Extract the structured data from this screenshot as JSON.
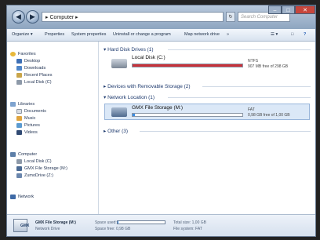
{
  "window": {
    "address": "▸ Computer ▸",
    "search_placeholder": "Search Computer",
    "back_glyph": "◀",
    "forward_glyph": "▶",
    "addr_dropdown": "▾",
    "refresh_glyph": "↻",
    "min": "–",
    "max": "□",
    "close": "✕"
  },
  "toolbar": {
    "organize": "Organize ▾",
    "properties": "Properties",
    "system_properties": "System properties",
    "uninstall": "Uninstall or change a program",
    "map_drive": "Map network drive",
    "more": "»",
    "view_icon": "☰ ▾",
    "pane_icon": "□",
    "help_icon": "?"
  },
  "sidebar": {
    "favorites": "Favorites",
    "desktop": "Desktop",
    "downloads": "Downloads",
    "recent": "Recent Places",
    "local_disk_fav": "Local Disk (C)",
    "libraries": "Libraries",
    "documents": "Documents",
    "music": "Music",
    "pictures": "Pictures",
    "videos": "Videos",
    "computer": "Computer",
    "local_disk": "Local Disk (C)",
    "gmx": "GMX File Storage (M:)",
    "zumodrive": "ZumoDrive (Z:)",
    "network": "Network"
  },
  "content": {
    "hdd_group": "Hard Disk Drives (1)",
    "local_disk_name": "Local Disk (C:)",
    "local_fs": "NTFS",
    "local_free": "907 MB free of 298 GB",
    "local_used_fraction": 0.997,
    "removable_group": "Devices with Removable Storage (2)",
    "network_group": "Network Location (1)",
    "gmx_name": "GMX File Storage (M:)",
    "gmx_fs": "FAT",
    "gmx_free": "0,98 GB free of 1,00 GB",
    "gmx_used_fraction": 0.02,
    "other_group": "Other (3)"
  },
  "details": {
    "name": "GMX File Storage (M:)",
    "type": "Network Drive",
    "space_used_label": "Space used:",
    "space_free": "Space free: 0,98 GB",
    "total_size": "Total size: 1,00 GB",
    "file_system": "File system: FAT",
    "icon_text": "GMX"
  },
  "colors": {
    "bar_full": "#c8323a",
    "bar_normal": "#3a8ee6"
  }
}
